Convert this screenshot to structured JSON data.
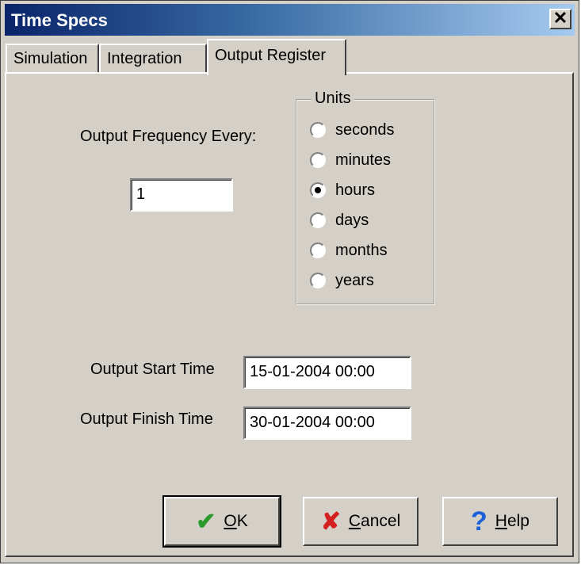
{
  "window": {
    "title": "Time Specs",
    "close_glyph": "✕"
  },
  "tabs": [
    {
      "label": "Simulation",
      "active": false
    },
    {
      "label": "Integration",
      "active": false
    },
    {
      "label": "Output Register",
      "active": true
    }
  ],
  "output_frequency": {
    "label": "Output Frequency Every:",
    "value": "1"
  },
  "units": {
    "legend": "Units",
    "options": [
      {
        "label": "seconds",
        "checked": false
      },
      {
        "label": "minutes",
        "checked": false
      },
      {
        "label": "hours",
        "checked": true
      },
      {
        "label": "days",
        "checked": false
      },
      {
        "label": "months",
        "checked": false
      },
      {
        "label": "years",
        "checked": false
      }
    ]
  },
  "output_start": {
    "label": "Output Start Time",
    "value": "15-01-2004 00:00"
  },
  "output_finish": {
    "label": "Output Finish Time",
    "value": "30-01-2004 00:00"
  },
  "buttons": {
    "ok": {
      "mnemonic": "O",
      "rest": "K",
      "icon": "check-icon"
    },
    "cancel": {
      "mnemonic": "C",
      "rest": "ancel",
      "icon": "x-icon"
    },
    "help": {
      "mnemonic": "H",
      "rest": "elp",
      "icon": "help-icon"
    }
  },
  "colors": {
    "face": "#d4d0c8",
    "title_start": "#0a246a",
    "title_end": "#a6caf0"
  }
}
